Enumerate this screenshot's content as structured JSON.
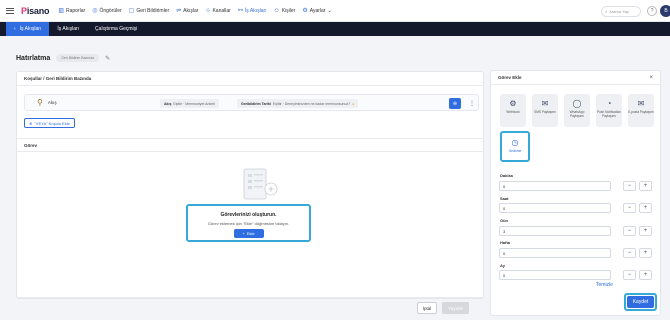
{
  "app": {
    "logo_prefix": "P",
    "logo_rest": "isano"
  },
  "nav": {
    "items": [
      {
        "icon": "bar-chart-icon",
        "label": "Raporlar"
      },
      {
        "icon": "lightbulb-icon",
        "label": "Öngörüler"
      },
      {
        "icon": "chat-icon",
        "label": "Geri Bildirimler"
      },
      {
        "icon": "flow-icon",
        "label": "Akışlar"
      },
      {
        "icon": "broadcast-icon",
        "label": "Kanallar"
      },
      {
        "icon": "task-flow-icon",
        "label": "İş Akışları"
      },
      {
        "icon": "person-icon",
        "label": "Kişiler"
      },
      {
        "icon": "gear-icon",
        "label": "Ayarlar"
      }
    ],
    "search_placeholder": "Arama Yap",
    "avatar_initial": "B"
  },
  "subnav": {
    "back_label": "İş Akışları",
    "tabs": [
      "İş Akışları",
      "Çalıştırma Geçmişi"
    ]
  },
  "page": {
    "title": "Hatırlatma",
    "badge": "Geri Bildirim Bazında"
  },
  "conditions": {
    "header": "Koşullar / Geri Bildirim Bazında",
    "row_label": "Akış",
    "chip1_key": "Akış",
    "chip1_text": "Eşittir · Memnuniyet Anketi",
    "chip2_key": "Geribildirim Tarihi",
    "chip2_text": "Eşittir · Deneyiminizden ne kadar memnunsunuz?",
    "add_label": "\"VEYA\" Koşulu Ekle"
  },
  "task": {
    "header": "Görev",
    "empty_title": "Görevlerinizi oluşturun.",
    "empty_desc": "Görev eklemek için \"Ekle\" düğmesine tıklayın.",
    "add_button": "Ekle"
  },
  "footer": {
    "cancel": "İptal",
    "publish": "Yayınla"
  },
  "panel": {
    "title": "Görev Ekle",
    "tiles": [
      {
        "icon": "webhook-icon",
        "label": "Webhook"
      },
      {
        "icon": "sms-icon",
        "label": "SMS Paylaşımı"
      },
      {
        "icon": "whatsapp-icon",
        "label": "WhatsApp Paylaşımı"
      },
      {
        "icon": "push-notification-icon",
        "label": "Push Notification Paylaşımı"
      },
      {
        "icon": "email-icon",
        "label": "E-posta Paylaşımı"
      },
      {
        "icon": "clock-icon",
        "label": "Gecikme"
      }
    ],
    "fields": [
      {
        "label": "Dakika",
        "value": "0"
      },
      {
        "label": "Saat",
        "value": "0"
      },
      {
        "label": "Gün",
        "value": "3"
      },
      {
        "label": "Hafta",
        "value": "0"
      },
      {
        "label": "Ay",
        "value": "0"
      }
    ],
    "reset": "Temizle",
    "save": "Kaydet"
  }
}
